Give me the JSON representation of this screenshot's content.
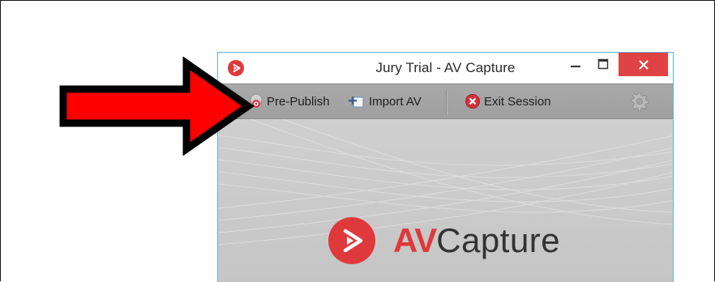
{
  "window": {
    "title": "Jury Trial - AV Capture"
  },
  "toolbar": {
    "pre_publish_label": "Pre-Publish",
    "import_label": "Import AV",
    "exit_label": "Exit Session"
  },
  "brand": {
    "av": "AV",
    "capture": "Capture"
  },
  "colors": {
    "accent_red": "#e0393c",
    "close_button": "#e04343",
    "window_border": "#63b2e0",
    "annotation_arrow": "#ff0000"
  },
  "icons": {
    "app": "av-capture-logo-icon",
    "pre_publish": "pre-publish-icon",
    "import": "import-icon",
    "exit": "exit-x-icon",
    "settings": "gear-icon",
    "annotation": "red-arrow-icon"
  }
}
